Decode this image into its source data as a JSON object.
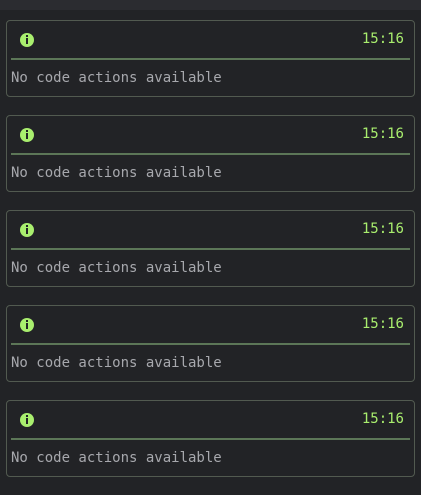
{
  "notifications": [
    {
      "icon": "info-icon",
      "time": "15:16",
      "message": "No code actions available"
    },
    {
      "icon": "info-icon",
      "time": "15:16",
      "message": "No code actions available"
    },
    {
      "icon": "info-icon",
      "time": "15:16",
      "message": "No code actions available"
    },
    {
      "icon": "info-icon",
      "time": "15:16",
      "message": "No code actions available"
    },
    {
      "icon": "info-icon",
      "time": "15:16",
      "message": "No code actions available"
    }
  ],
  "colors": {
    "accent": "#a9ee6e",
    "divider": "#5c7657",
    "border": "#525a50",
    "background": "#222326",
    "text": "#a7a8ad"
  }
}
